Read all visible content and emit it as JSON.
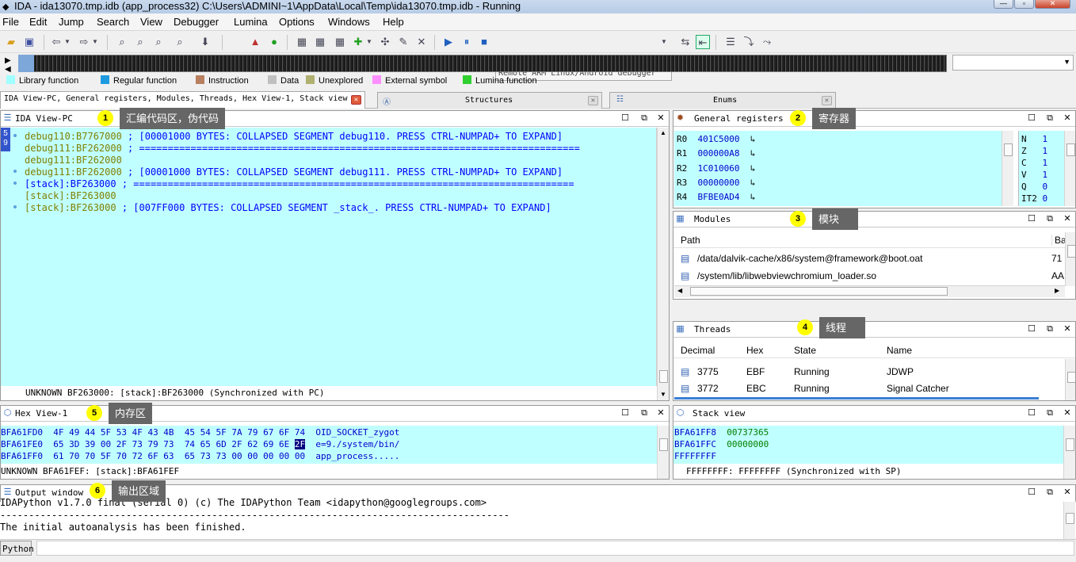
{
  "window": {
    "title": "IDA - ida13070.tmp.idb (app_process32) C:\\Users\\ADMINI~1\\AppData\\Local\\Temp\\ida13070.tmp.idb - Running"
  },
  "menu": [
    "File",
    "Edit",
    "Jump",
    "Search",
    "View",
    "Debugger",
    "Lumina",
    "Options",
    "Windows",
    "Help"
  ],
  "toolbar": {
    "debugger_select": "Remote ARM Linux/Android debugger"
  },
  "legend": [
    {
      "label": "Library function",
      "color": "#a0ffff"
    },
    {
      "label": "Regular function",
      "color": "#1e9be0"
    },
    {
      "label": "Instruction",
      "color": "#b88060"
    },
    {
      "label": "Data",
      "color": "#c0c0c0"
    },
    {
      "label": "Unexplored",
      "color": "#b0b070"
    },
    {
      "label": "External symbol",
      "color": "#ff90ff"
    },
    {
      "label": "Lumina function",
      "color": "#30d030"
    }
  ],
  "tabs": [
    {
      "label": "IDA View-PC, General registers, Modules, Threads, Hex View-1, Stack view"
    },
    {
      "label": "Structures"
    },
    {
      "label": "Enums"
    }
  ],
  "ida_view": {
    "title": "IDA View-PC",
    "lines": [
      {
        "addr": "debug110:B7767000",
        "text": " ; [00001000 BYTES: COLLAPSED SEGMENT debug110. PRESS CTRL-NUMPAD+ TO EXPAND]"
      },
      {
        "addr": "debug111:BF262000",
        "text": " ; ============================================================================="
      },
      {
        "addr": "debug111:BF262000",
        "text": ""
      },
      {
        "addr": "debug111:BF262000",
        "text": " ; [00001000 BYTES: COLLAPSED SEGMENT debug111. PRESS CTRL-NUMPAD+ TO EXPAND]"
      },
      {
        "addr": "[stack]:BF263000",
        "text": " ; ============================================================================="
      },
      {
        "addr": "[stack]:BF263000",
        "text": ""
      },
      {
        "addr": "[stack]:BF263000",
        "text": " ; [007FF000 BYTES: COLLAPSED SEGMENT _stack_. PRESS CTRL-NUMPAD+ TO EXPAND]"
      }
    ],
    "status": "UNKNOWN BF263000: [stack]:BF263000 (Synchronized with PC)",
    "gutter": "5 9"
  },
  "registers": {
    "title": "General registers",
    "rows": [
      {
        "name": "R0",
        "value": "401C5000"
      },
      {
        "name": "R1",
        "value": "000000A8"
      },
      {
        "name": "R2",
        "value": "1C010060"
      },
      {
        "name": "R3",
        "value": "00000000"
      },
      {
        "name": "R4",
        "value": "BFBE0AD4"
      }
    ],
    "flags": [
      {
        "name": "N",
        "value": "1"
      },
      {
        "name": "Z",
        "value": "1"
      },
      {
        "name": "C",
        "value": "1"
      },
      {
        "name": "V",
        "value": "1"
      },
      {
        "name": "Q",
        "value": "0"
      },
      {
        "name": "IT2",
        "value": "0"
      }
    ]
  },
  "modules": {
    "title": "Modules",
    "headers": [
      "Path",
      "Ba"
    ],
    "rows": [
      {
        "path": "/data/dalvik-cache/x86/system@framework@boot.oat",
        "base": "71"
      },
      {
        "path": "/system/lib/libwebviewchromium_loader.so",
        "base": "AA"
      }
    ]
  },
  "threads": {
    "title": "Threads",
    "headers": [
      "Decimal",
      "Hex",
      "State",
      "Name"
    ],
    "rows": [
      {
        "dec": "3775",
        "hex": "EBF",
        "state": "Running",
        "name": "JDWP"
      },
      {
        "dec": "3772",
        "hex": "EBC",
        "state": "Running",
        "name": "Signal Catcher"
      }
    ]
  },
  "hex_view": {
    "title": "Hex View-1",
    "lines": [
      {
        "addr": "BFA61FD0",
        "bytes_a": "4F 49 44 5F 53 4F 43 4B",
        "bytes_b": "45 54 5F 7A 79 67 6F 74",
        "ascii": "OID_SOCKET_zygot"
      },
      {
        "addr": "BFA61FE0",
        "bytes_a": "65 3D 39 00 2F 73 79 73",
        "bytes_b": "74 65 6D 2F 62 69 6E ",
        "sel": "2F",
        "ascii": "e=9./system/bin/"
      },
      {
        "addr": "BFA61FF0",
        "bytes_a": "61 70 70 5F 70 72 6F 63",
        "bytes_b": "65 73 73 00 00 00 00 00",
        "ascii": "app_process....."
      }
    ],
    "status": "UNKNOWN BFA61FEF: [stack]:BFA61FEF"
  },
  "stack_view": {
    "title": "Stack view",
    "lines": [
      {
        "addr": "BFA61FF8",
        "value": "00737365"
      },
      {
        "addr": "BFA61FFC",
        "value": "00000000"
      },
      {
        "addr": "FFFFFFFF",
        "value": ""
      }
    ],
    "status": "FFFFFFFF: FFFFFFFF (Synchronized with SP)"
  },
  "output": {
    "title": "Output window",
    "lines": [
      "IDAPython v1.7.0 final (serial 0) (c) The IDAPython Team <idapython@googlegroups.com>",
      "-----------------------------------------------------------------------------------------",
      "The initial autoanalysis has been finished."
    ],
    "python_label": "Python"
  },
  "annotations": [
    {
      "num": "1",
      "label": "汇编代码区，伪代码"
    },
    {
      "num": "2",
      "label": "寄存器"
    },
    {
      "num": "3",
      "label": "模块"
    },
    {
      "num": "4",
      "label": "线程"
    },
    {
      "num": "5",
      "label": "内存区"
    },
    {
      "num": "6",
      "label": "输出区域"
    }
  ]
}
